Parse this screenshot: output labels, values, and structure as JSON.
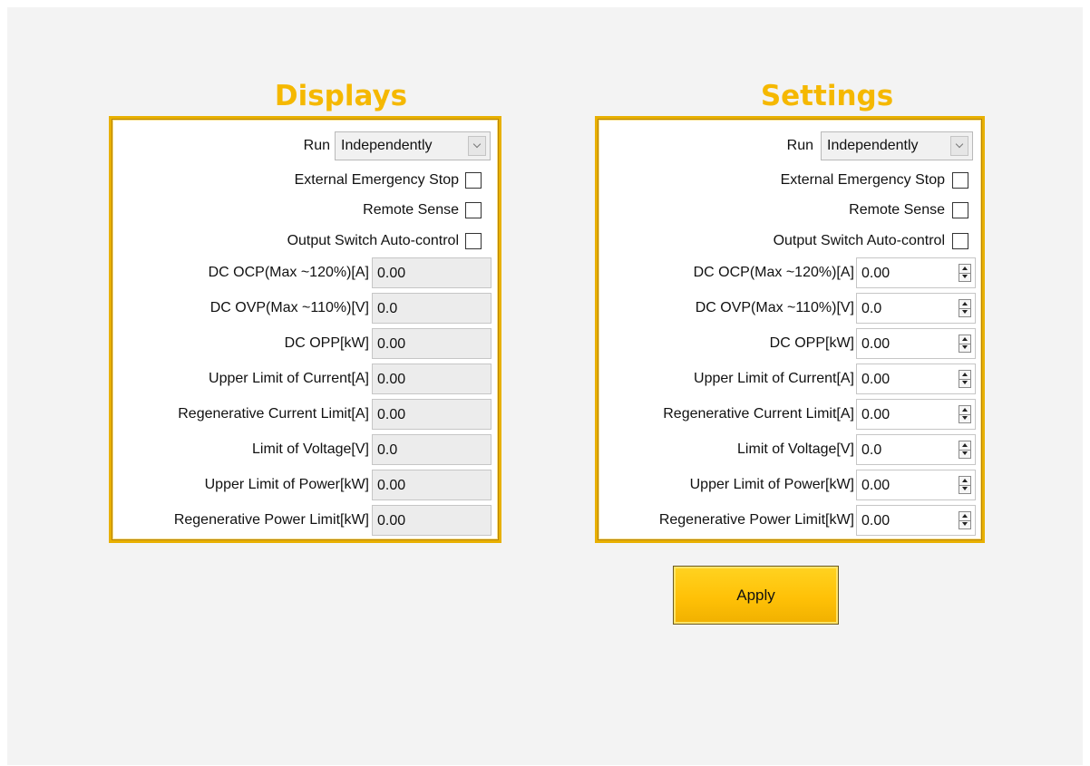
{
  "displays": {
    "title": "Displays",
    "run_label": "Run",
    "run_value": "Independently",
    "checkboxes": [
      {
        "label": "External Emergency Stop",
        "checked": false
      },
      {
        "label": "Remote Sense",
        "checked": false
      },
      {
        "label": "Output Switch Auto-control",
        "checked": false
      }
    ],
    "fields": [
      {
        "label": "DC OCP(Max ~120%)[A]",
        "value": "0.00"
      },
      {
        "label": "DC OVP(Max ~110%)[V]",
        "value": "0.0"
      },
      {
        "label": "DC OPP[kW]",
        "value": "0.00"
      },
      {
        "label": "Upper Limit of Current[A]",
        "value": "0.00"
      },
      {
        "label": "Regenerative Current Limit[A]",
        "value": "0.00"
      },
      {
        "label": "Limit of Voltage[V]",
        "value": "0.0"
      },
      {
        "label": "Upper Limit of Power[kW]",
        "value": "0.00"
      },
      {
        "label": "Regenerative Power Limit[kW]",
        "value": "0.00"
      }
    ]
  },
  "settings": {
    "title": "Settings",
    "run_label": "Run",
    "run_value": "Independently",
    "checkboxes": [
      {
        "label": "External Emergency Stop",
        "checked": false
      },
      {
        "label": "Remote Sense",
        "checked": false
      },
      {
        "label": "Output Switch Auto-control",
        "checked": false
      }
    ],
    "fields": [
      {
        "label": "DC OCP(Max ~120%)[A]",
        "value": "0.00"
      },
      {
        "label": "DC OVP(Max ~110%)[V]",
        "value": "0.0"
      },
      {
        "label": "DC OPP[kW]",
        "value": "0.00"
      },
      {
        "label": "Upper Limit of Current[A]",
        "value": "0.00"
      },
      {
        "label": "Regenerative Current Limit[A]",
        "value": "0.00"
      },
      {
        "label": "Limit of Voltage[V]",
        "value": "0.0"
      },
      {
        "label": "Upper Limit of Power[kW]",
        "value": "0.00"
      },
      {
        "label": "Regenerative Power Limit[kW]",
        "value": "0.00"
      }
    ]
  },
  "apply_label": "Apply",
  "colors": {
    "title": "#f5b800",
    "panel_border": "#e8b000",
    "apply_button": "#ffc107"
  }
}
